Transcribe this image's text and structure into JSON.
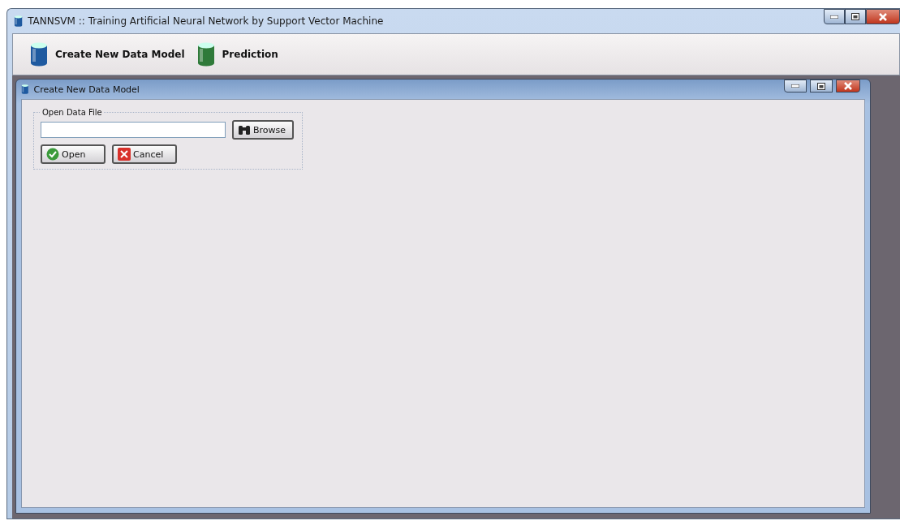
{
  "window": {
    "title": "TANNSVM :: Training Artificial Neural Network by Support Vector Machine"
  },
  "toolbar": {
    "items": [
      {
        "label": "Create New Data Model",
        "kind": "blue"
      },
      {
        "label": "Prediction",
        "kind": "green"
      }
    ]
  },
  "child_window": {
    "title": "Create New Data Model",
    "group": {
      "title": "Open Data File",
      "browse_button": "Browse",
      "buttons": [
        {
          "label": "Open",
          "kind": "ok"
        },
        {
          "label": "Cancel",
          "kind": "cancel"
        }
      ]
    }
  }
}
